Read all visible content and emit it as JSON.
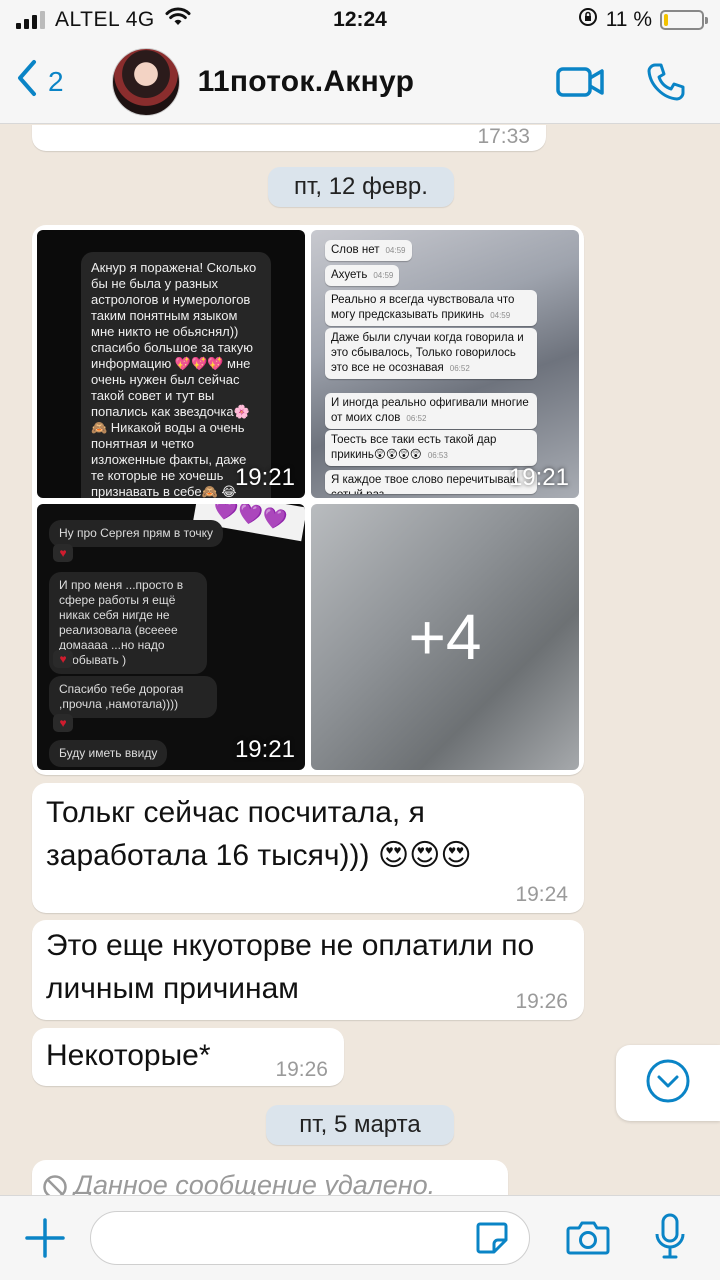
{
  "status_bar": {
    "carrier": "ALTEL 4G",
    "time": "12:24",
    "battery": "11 %",
    "battery_level": 0.11
  },
  "header": {
    "back_count": "2",
    "contact_name": "11поток.Акнур"
  },
  "chat": {
    "top_time": "17:33",
    "date_1": "пт, 12 февр.",
    "album": {
      "tile_times": [
        "19:21",
        "19:21",
        "19:21"
      ],
      "more_label": "+4",
      "tile1_text": "Акнур я поражена! Сколько бы не была у разных астрологов и нумерологов таким понятным языком мне никто не обьяснял)) спасибо большое за такую информацию 💖💖💖 мне очень нужен был сейчас такой совет и тут вы попались как звездочка🌸🙈 Никакой воды а очень понятная и четко изложенные факты, даже те которые не хочешь признавать в себе🙈 😂 Благодарю вас 🧡",
      "tile2_messages": [
        {
          "text": "Слов нет",
          "time": "04:59"
        },
        {
          "text": "Ахуеть",
          "time": "04:59"
        },
        {
          "text": "Реально я всегда чувствовала что могу предсказывать прикинь",
          "time": "04:59"
        },
        {
          "text": "Даже были случаи когда говорила и это сбывалось, Только говорилось это все не осознавая",
          "time": "06:52"
        },
        {
          "text": "И иногда реально офигивали многие от моих слов",
          "time": "06:52"
        },
        {
          "text": "Тоесть все таки есть такой дар прикинь😲😲😲😲",
          "time": "06:53"
        },
        {
          "text": "Я каждое твое слово перечитываю сотый раз",
          "time": ""
        }
      ],
      "tile3_messages": [
        "Ну про Сергея прям в точку",
        "И про меня ...просто в сфере работы я ещё никак себя нигде не реализовала (всееее домаааа ...но надо пробывать )",
        "Спасибо тебе дорогая ,прочла ,намотала))))",
        "Буду иметь ввиду"
      ]
    },
    "messages": [
      {
        "text": "Толькг сейчас посчитала, я заработала 16 тысяч))) 😍😍😍",
        "time": "19:24"
      },
      {
        "text": "Это еще нкуоторве не оплатили по личным причинам",
        "time": "19:26"
      },
      {
        "text": "Некоторые*",
        "time": "19:26"
      }
    ],
    "date_2": "пт, 5 марта",
    "deleted_text": "Данное сообщение удалено."
  },
  "input": {
    "placeholder": ""
  },
  "colors": {
    "accent": "#0a84c6",
    "bubble": "#ffffff",
    "background": "#efe7dd"
  },
  "icons": [
    "signal-icon",
    "wifi-icon",
    "lock-rotation-icon",
    "battery-icon",
    "back-chevron-icon",
    "video-call-icon",
    "phone-call-icon",
    "chevron-down-icon",
    "plus-icon",
    "sticker-icon",
    "camera-icon",
    "mic-icon",
    "deleted-icon"
  ]
}
